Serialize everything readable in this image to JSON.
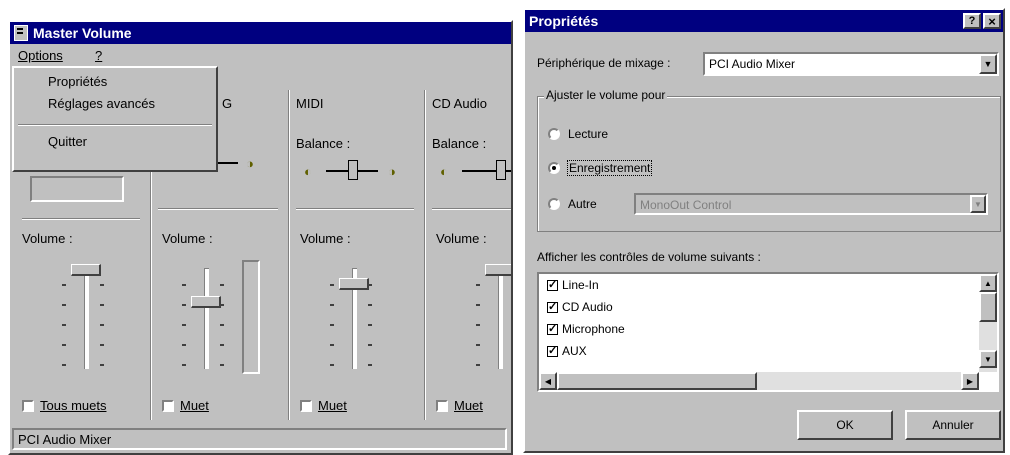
{
  "master": {
    "title": "Master Volume",
    "menu_options": "Options",
    "menu_help": "?",
    "dropdown": {
      "item1": "Propriétés",
      "item2": "Réglages avancés",
      "item3": "Quitter"
    },
    "channels": [
      {
        "name": "",
        "balance": "",
        "volume": "Volume :",
        "mute": "Tous muets"
      },
      {
        "name": "G",
        "balance": "",
        "volume": "Volume :",
        "mute": "Muet"
      },
      {
        "name": "MIDI",
        "balance": "Balance :",
        "volume": "Volume :",
        "mute": "Muet"
      },
      {
        "name": "CD Audio",
        "balance": "Balance :",
        "volume": "Volume :",
        "mute": "Muet"
      }
    ],
    "status": "PCI Audio Mixer"
  },
  "props": {
    "title": "Propriétés",
    "help_btn": "?",
    "close_btn": "×",
    "device_label": "Périphérique de mixage :",
    "device_value": "PCI Audio Mixer",
    "group_label": "Ajuster le volume pour",
    "radio_playback": "Lecture",
    "radio_record": "Enregistrement",
    "radio_other": "Autre",
    "other_value": "MonoOut Control",
    "list_label": "Afficher les contrôles de volume suivants :",
    "list_items": [
      "Line-In",
      "CD Audio",
      "Microphone",
      "AUX"
    ],
    "ok": "OK",
    "cancel": "Annuler",
    "selected_radio": "Enregistrement"
  }
}
